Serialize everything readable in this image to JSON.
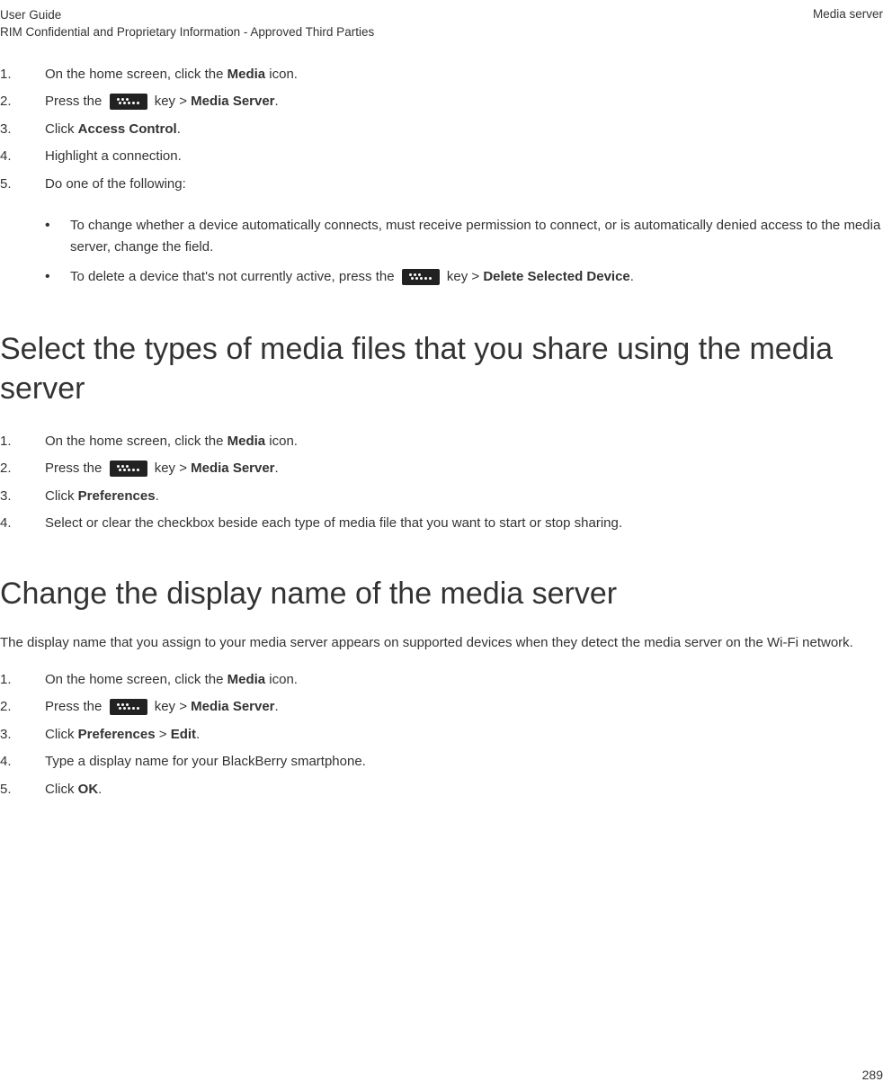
{
  "header": {
    "guide": "User Guide",
    "confidential": "RIM Confidential and Proprietary Information - Approved Third Parties",
    "section": "Media server"
  },
  "list1": {
    "n1": "1.",
    "t1a": "On the home screen, click the ",
    "t1b": "Media",
    "t1c": " icon.",
    "n2": "2.",
    "t2a": "Press the ",
    "t2b": " key > ",
    "t2c": "Media Server",
    "t2d": ".",
    "n3": "3.",
    "t3a": "Click ",
    "t3b": "Access Control",
    "t3c": ".",
    "n4": "4.",
    "t4": "Highlight a connection.",
    "n5": "5.",
    "t5": "Do one of the following:",
    "sub": {
      "b1": "To change whether a device automatically connects, must receive permission to connect, or is automatically denied access to the media server, change the field.",
      "b2a": "To delete a device that's not currently active, press the ",
      "b2b": " key > ",
      "b2c": "Delete Selected Device",
      "b2d": "."
    }
  },
  "h2": "Select the types of media files that you share using the media server",
  "list2": {
    "n1": "1.",
    "t1a": "On the home screen, click the ",
    "t1b": "Media",
    "t1c": " icon.",
    "n2": "2.",
    "t2a": "Press the ",
    "t2b": " key > ",
    "t2c": "Media Server",
    "t2d": ".",
    "n3": "3.",
    "t3a": "Click ",
    "t3b": "Preferences",
    "t3c": ".",
    "n4": "4.",
    "t4": "Select or clear the checkbox beside each type of media file that you want to start or stop sharing."
  },
  "h3": "Change the display name of the media server",
  "para3": "The display name that you assign to your media server appears on supported devices when they detect the media server on the Wi-Fi network.",
  "list3": {
    "n1": "1.",
    "t1a": "On the home screen, click the ",
    "t1b": "Media",
    "t1c": " icon.",
    "n2": "2.",
    "t2a": "Press the ",
    "t2b": " key > ",
    "t2c": "Media Server",
    "t2d": ".",
    "n3": "3.",
    "t3a": "Click ",
    "t3b": "Preferences",
    "t3c": " > ",
    "t3d": "Edit",
    "t3e": ".",
    "n4": "4.",
    "t4": "Type a display name for your BlackBerry smartphone.",
    "n5": "5.",
    "t5a": "Click ",
    "t5b": "OK",
    "t5c": "."
  },
  "page": "289"
}
